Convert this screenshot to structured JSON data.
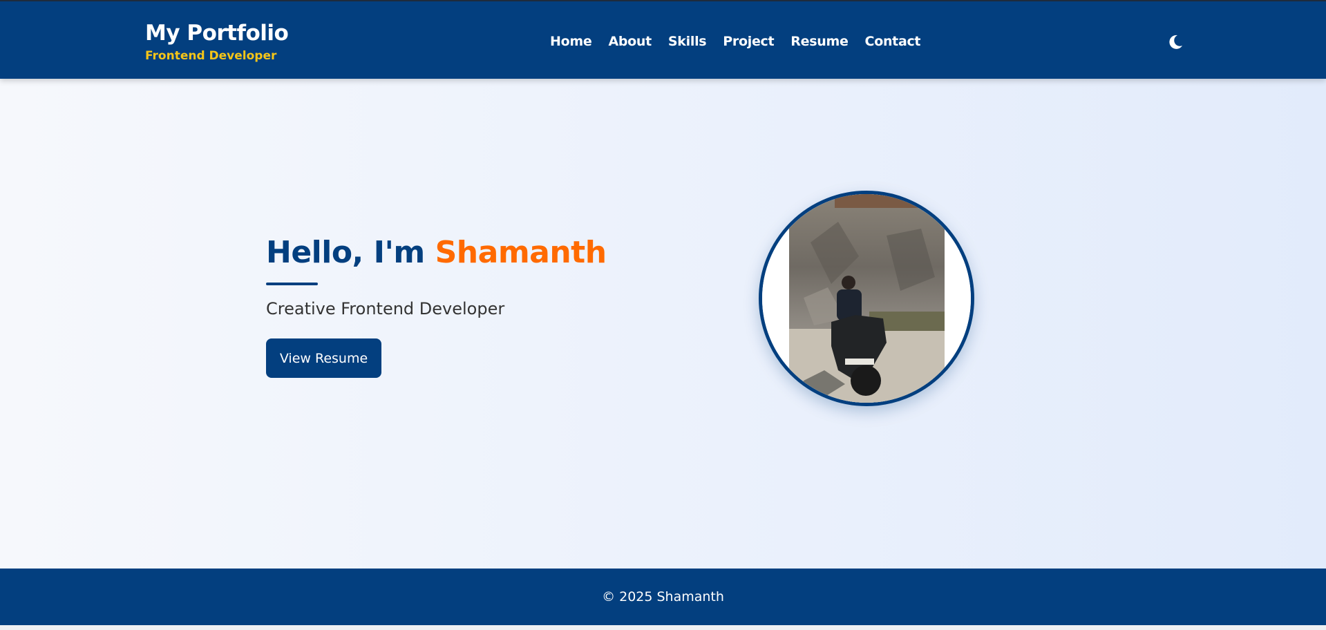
{
  "header": {
    "brand_title": "My Portfolio",
    "brand_subtitle": "Frontend Developer",
    "nav": [
      "Home",
      "About",
      "Skills",
      "Project",
      "Resume",
      "Contact"
    ],
    "theme_toggle_icon": "moon-icon"
  },
  "hero": {
    "greeting": "Hello, I'm",
    "name": "Shamanth",
    "subtitle": "Creative Frontend Developer",
    "button_label": "View Resume",
    "photo_icon": "profile-photo"
  },
  "footer": {
    "copyright": "© 2025 Shamanth"
  },
  "colors": {
    "primary": "#033f7f",
    "accent": "#ff6a00",
    "brand_subtitle": "#f5c518"
  }
}
